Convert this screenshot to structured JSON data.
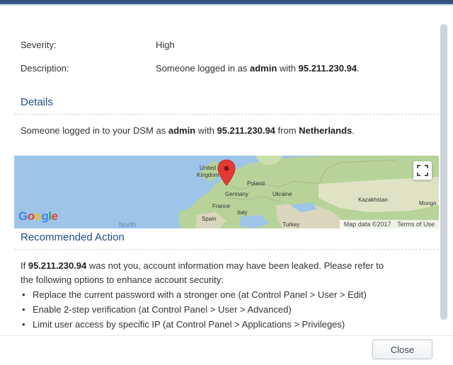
{
  "details_rows": {
    "severity": {
      "label": "Severity:",
      "value": "High"
    },
    "description": {
      "label": "Description:",
      "prefix": "Someone logged in as ",
      "user": "admin",
      "mid": " with ",
      "ip": "95.211.230.94",
      "suffix": "."
    }
  },
  "details_section": {
    "title": "Details",
    "prefix": "Someone logged in to your DSM as ",
    "user": "admin",
    "mid": " with ",
    "ip": "95.211.230.94",
    "mid2": " from ",
    "country": "Netherlands",
    "suffix": "."
  },
  "map": {
    "labels": {
      "uk1": "United",
      "uk2": "Kingdom",
      "poland": "Poland",
      "germany": "Germany",
      "ukraine": "Ukraine",
      "france": "France",
      "italy": "Italy",
      "spain": "Spain",
      "turkey": "Turkey",
      "kazakhstan": "Kazakhstan",
      "mongolia": "Mongo",
      "ocean": "North"
    },
    "google": [
      "G",
      "o",
      "o",
      "g",
      "l",
      "e"
    ],
    "google_colors": [
      "#4285f4",
      "#ea4335",
      "#fbbc05",
      "#4285f4",
      "#34a853",
      "#ea4335"
    ],
    "attribution": "Map data ©2017",
    "terms": "Terms of Use",
    "pin_color": "#e53935",
    "fullscreen_icon": "fullscreen-icon"
  },
  "recommended": {
    "title": "Recommended Action",
    "line1_prefix": "If ",
    "ip": "95.211.230.94",
    "line1_suffix": " was not you, account information may have been leaked. Please refer to",
    "line2": "the following options to enhance account security:",
    "options": [
      "Replace the current password with a stronger one (at Control Panel > User > Edit)",
      "Enable 2-step verification (at Control Panel > User > Advanced)",
      "Limit user access by specific IP (at Control Panel > Applications > Privileges)"
    ]
  },
  "footer": {
    "close_label": "Close"
  }
}
